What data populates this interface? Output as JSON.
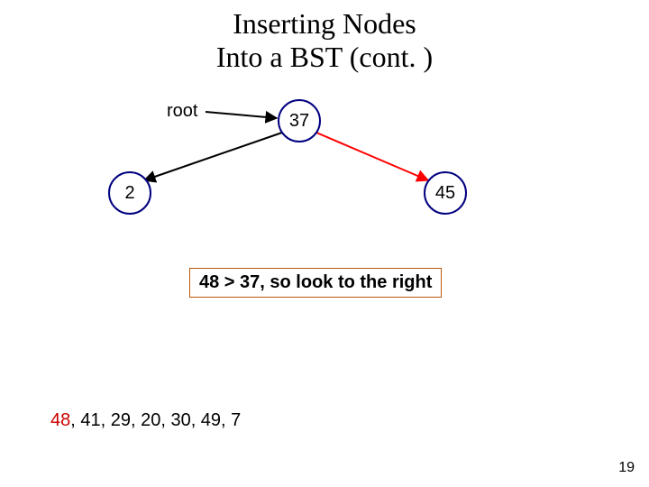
{
  "title_line1": "Inserting Nodes",
  "title_line2": "Into a BST (cont. )",
  "root_label": "root",
  "nodes": {
    "root": "37",
    "left": "2",
    "right": "45"
  },
  "caption": "48 > 37, so look to the right",
  "sequence": {
    "highlight": "48",
    "rest": ", 41, 29, 20, 30, 49, 7"
  },
  "page_number": "19",
  "colors": {
    "node_border": "#000080",
    "edge_highlight": "#ff0000",
    "edge_normal": "#000000",
    "caption_border": "#b9590a",
    "sequence_highlight": "#cc0000"
  }
}
